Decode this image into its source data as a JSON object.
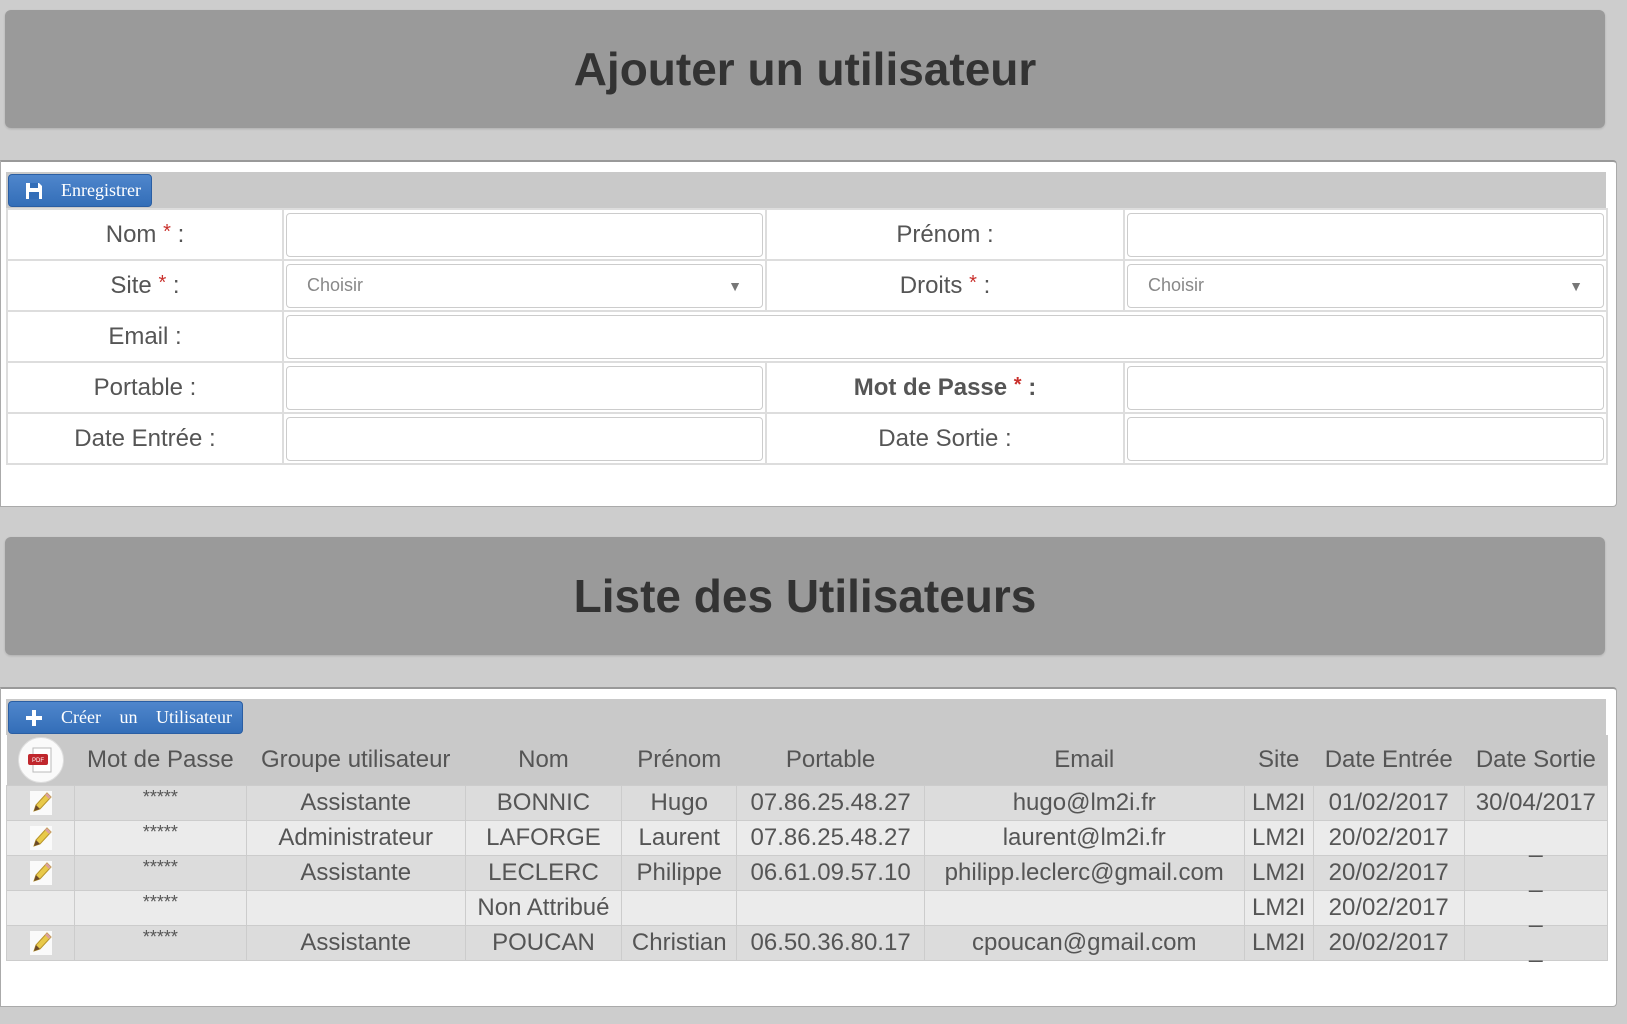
{
  "add_section": {
    "title": "Ajouter un utilisateur",
    "save_button": "Enregistrer",
    "fields": {
      "nom_label": "Nom",
      "prenom_label": "Prénom :",
      "site_label": "Site",
      "site_placeholder": "Choisir",
      "droits_label": "Droits",
      "droits_placeholder": "Choisir",
      "email_label": "Email :",
      "portable_label": "Portable :",
      "mot_de_passe_label": "Mot de Passe",
      "date_entree_label": "Date Entrée :",
      "date_sortie_label": "Date Sortie :",
      "required_mark": "*",
      "colon": ":"
    }
  },
  "list_section": {
    "title": "Liste des Utilisateurs",
    "create_button": "Créer un Utilisateur",
    "pdf_label": "PDF",
    "columns": [
      "Mot de Passe",
      "Groupe utilisateur",
      "Nom",
      "Prénom",
      "Portable",
      "Email",
      "Site",
      "Date Entrée",
      "Date Sortie"
    ],
    "rows": [
      {
        "editable": true,
        "password": "*****",
        "group": "Assistante",
        "nom": "BONNIC",
        "prenom": "Hugo",
        "portable": "07.86.25.48.27",
        "email": "hugo@lm2i.fr",
        "site": "LM2I",
        "date_entree": "01/02/2017",
        "date_sortie": "30/04/2017"
      },
      {
        "editable": true,
        "password": "*****",
        "group": "Administrateur",
        "nom": "LAFORGE",
        "prenom": "Laurent",
        "portable": "07.86.25.48.27",
        "email": "laurent@lm2i.fr",
        "site": "LM2I",
        "date_entree": "20/02/2017",
        "date_sortie": "_"
      },
      {
        "editable": true,
        "password": "*****",
        "group": "Assistante",
        "nom": "LECLERC",
        "prenom": "Philippe",
        "portable": "06.61.09.57.10",
        "email": "philipp.leclerc@gmail.com",
        "site": "LM2I",
        "date_entree": "20/02/2017",
        "date_sortie": "_"
      },
      {
        "editable": false,
        "password": "*****",
        "group": "",
        "nom": "Non Attribué",
        "prenom": "",
        "portable": "",
        "email": "",
        "site": "LM2I",
        "date_entree": "20/02/2017",
        "date_sortie": "_"
      },
      {
        "editable": true,
        "password": "*****",
        "group": "Assistante",
        "nom": "POUCAN",
        "prenom": "Christian",
        "portable": "06.50.36.80.17",
        "email": "cpoucan@gmail.com",
        "site": "LM2I",
        "date_entree": "20/02/2017",
        "date_sortie": "_"
      }
    ]
  },
  "colors": {
    "primary_button": "#336eb8",
    "header_bar": "#9a9a9a",
    "required": "#c9302c"
  }
}
